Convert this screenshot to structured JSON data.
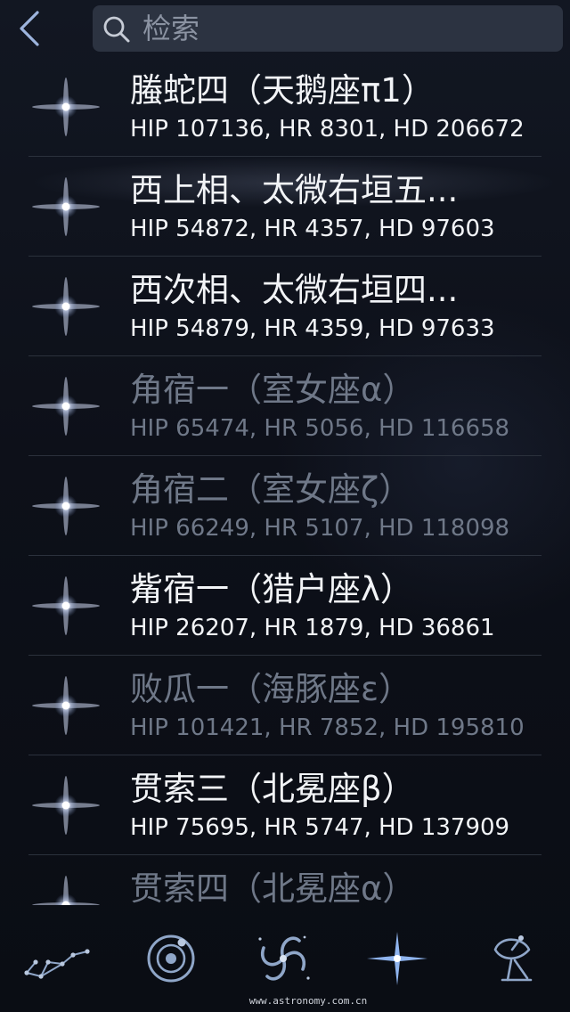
{
  "search": {
    "placeholder": "检索"
  },
  "results": [
    {
      "name": "螣蛇四（天鹅座π1）",
      "ids": "HIP 107136, HR 8301, HD 206672",
      "dim": false
    },
    {
      "name": "西上相、太微右垣五...",
      "ids": "HIP 54872, HR 4357, HD 97603",
      "dim": false
    },
    {
      "name": "西次相、太微右垣四...",
      "ids": "HIP 54879, HR 4359, HD 97633",
      "dim": false
    },
    {
      "name": "角宿一（室女座α）",
      "ids": "HIP 65474, HR 5056, HD 116658",
      "dim": true
    },
    {
      "name": "角宿二（室女座ζ）",
      "ids": "HIP 66249, HR 5107, HD 118098",
      "dim": true
    },
    {
      "name": "觜宿一（猎户座λ）",
      "ids": "HIP 26207, HR 1879, HD 36861",
      "dim": false
    },
    {
      "name": "败瓜一（海豚座ε）",
      "ids": "HIP 101421, HR 7852, HD 195810",
      "dim": true
    },
    {
      "name": "贯索三（北冕座β）",
      "ids": "HIP 75695, HR 5747, HD 137909",
      "dim": false
    },
    {
      "name": "贯索四（北冕座α）",
      "ids": "",
      "dim": true
    }
  ],
  "tabs": [
    {
      "icon": "constellation-icon"
    },
    {
      "icon": "solar-system-icon"
    },
    {
      "icon": "galaxy-icon"
    },
    {
      "icon": "star-icon",
      "active": true
    },
    {
      "icon": "satellite-dish-icon"
    }
  ],
  "footer": {
    "watermark": "www.astronomy.com.cn"
  },
  "colors": {
    "text": "#f2f4f7",
    "dim_text": "#6f7888",
    "search_bg": "#2c3341",
    "accent": "#7ea2d8"
  }
}
